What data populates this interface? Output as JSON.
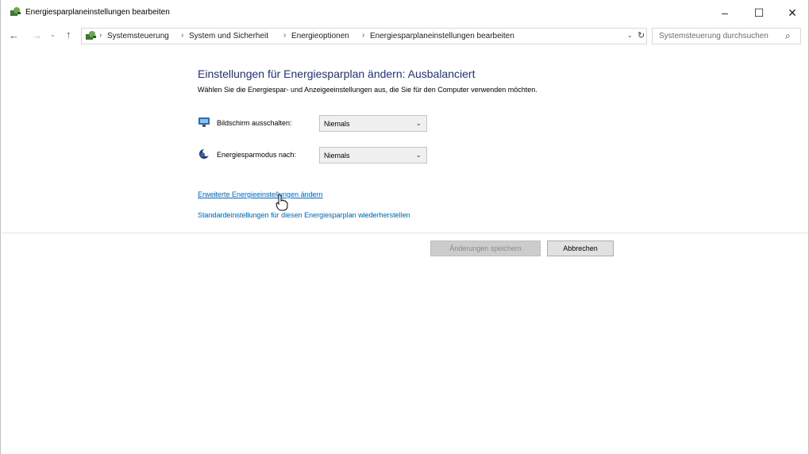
{
  "window": {
    "title": "Energiesparplaneinstellungen bearbeiten",
    "controls": {
      "minimize": "–",
      "maximize": "☐",
      "close": "✕"
    }
  },
  "nav": {
    "back_icon": "←",
    "forward_icon": "→",
    "recent_icon": "⌄",
    "up_icon": "↑",
    "breadcrumb": [
      "Systemsteuerung",
      "System und Sicherheit",
      "Energieoptionen",
      "Energiesparplaneinstellungen bearbeiten"
    ],
    "separator": "›",
    "dropdown_icon": "⌄",
    "refresh_icon": "↻",
    "search_placeholder": "Systemsteuerung durchsuchen",
    "search_icon": "⌕"
  },
  "main": {
    "heading": "Einstellungen für Energiesparplan ändern: Ausbalanciert",
    "subtext": "Wählen Sie die Energiespar- und Anzeigeeinstellungen aus, die Sie für den Computer verwenden möchten.",
    "settings": [
      {
        "label": "Bildschirm ausschalten:",
        "value": "Niemals",
        "icon": "monitor-icon"
      },
      {
        "label": "Energiesparmodus nach:",
        "value": "Niemals",
        "icon": "moon-icon"
      }
    ],
    "select_arrow": "⌄",
    "links": {
      "advanced": "Erweiterte Energieeinstellungen ändern",
      "restore": "Standardeinstellungen für diesen Energiesparplan wiederherstellen"
    }
  },
  "buttons": {
    "save": "Änderungen speichern",
    "cancel": "Abbrechen"
  },
  "colors": {
    "heading": "#1e3287",
    "link": "#0066cc",
    "disabled_button": "#cccccc"
  }
}
